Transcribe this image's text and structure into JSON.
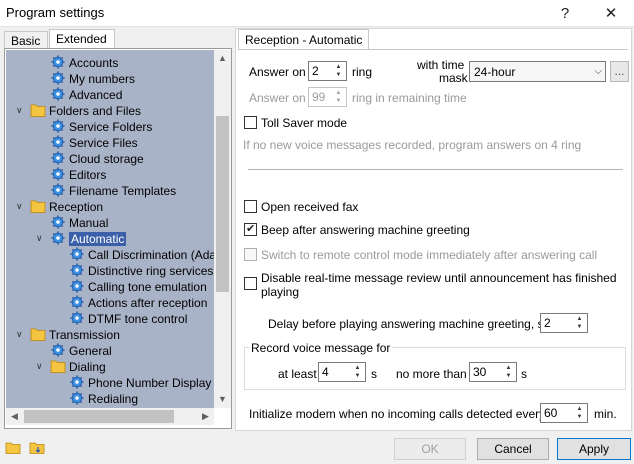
{
  "window": {
    "title": "Program settings",
    "help": "?",
    "close": "✕"
  },
  "left_tabs": {
    "basic": "Basic",
    "extended": "Extended"
  },
  "tree": [
    {
      "label": "Accounts",
      "icon": "gear-icon",
      "level": 2
    },
    {
      "label": "My numbers",
      "icon": "gear-icon",
      "level": 2
    },
    {
      "label": "Advanced",
      "icon": "gear-icon",
      "level": 2
    },
    {
      "label": "Folders and Files",
      "icon": "folder-icon",
      "level": 1,
      "expander": "collapse"
    },
    {
      "label": "Service Folders",
      "icon": "gear-icon",
      "level": 2
    },
    {
      "label": "Service Files",
      "icon": "gear-icon",
      "level": 2
    },
    {
      "label": "Cloud storage",
      "icon": "gear-icon",
      "level": 2
    },
    {
      "label": "Editors",
      "icon": "gear-icon",
      "level": 2
    },
    {
      "label": "Filename Templates",
      "icon": "gear-icon",
      "level": 2
    },
    {
      "label": "Reception",
      "icon": "folder-icon",
      "level": 1,
      "expander": "collapse"
    },
    {
      "label": "Manual",
      "icon": "gear-icon",
      "level": 2
    },
    {
      "label": "Automatic",
      "icon": "gear-icon",
      "level": 2,
      "expander": "collapse",
      "selected": true
    },
    {
      "label": "Call Discrimination (Ada",
      "icon": "gear-icon",
      "level": 3
    },
    {
      "label": "Distinctive ring services",
      "icon": "gear-icon",
      "level": 3
    },
    {
      "label": "Calling tone emulation",
      "icon": "gear-icon",
      "level": 3
    },
    {
      "label": "Actions after reception",
      "icon": "gear-icon",
      "level": 3
    },
    {
      "label": "DTMF tone control",
      "icon": "gear-icon",
      "level": 3
    },
    {
      "label": "Transmission",
      "icon": "folder-icon",
      "level": 1,
      "expander": "collapse"
    },
    {
      "label": "General",
      "icon": "gear-icon",
      "level": 2
    },
    {
      "label": "Dialing",
      "icon": "folder-icon",
      "level": 2,
      "expander": "collapse"
    },
    {
      "label": "Phone Number Display",
      "icon": "gear-icon",
      "level": 3
    },
    {
      "label": "Redialing",
      "icon": "gear-icon",
      "level": 3
    }
  ],
  "panel": {
    "tab": "Reception - Automatic",
    "answer_on_label": "Answer on",
    "answer_on_value": "2",
    "ring_label": "ring",
    "with_time_mask_l1": "with time",
    "with_time_mask_l2": "mask",
    "time_mask_value": "24-hour",
    "ellipsis": "...",
    "answer_on2_label": "Answer on",
    "answer_on2_value": "99",
    "ring_remaining_label": "ring in remaining time",
    "toll_saver": "Toll Saver mode",
    "toll_saver_note": "If no new voice messages recorded, program answers on 4 ring",
    "open_fax": "Open received fax",
    "beep_after": "Beep after answering machine greeting",
    "switch_remote": "Switch to remote control mode immediately after answering call",
    "disable_review_l1": "Disable real-time message review until announcement has finished",
    "disable_review_l2": "playing",
    "delay_label": "Delay before playing answering machine greeting, s",
    "delay_value": "2",
    "record_group": "Record voice message for",
    "at_least_label": "at least",
    "at_least_value": "4",
    "at_least_unit": "s",
    "no_more_label": "no more than",
    "no_more_value": "30",
    "no_more_unit": "s",
    "init_label": "Initialize modem when no incoming calls detected every",
    "init_value": "60",
    "init_unit": "min."
  },
  "buttons": {
    "ok": "OK",
    "cancel": "Cancel",
    "apply": "Apply"
  }
}
